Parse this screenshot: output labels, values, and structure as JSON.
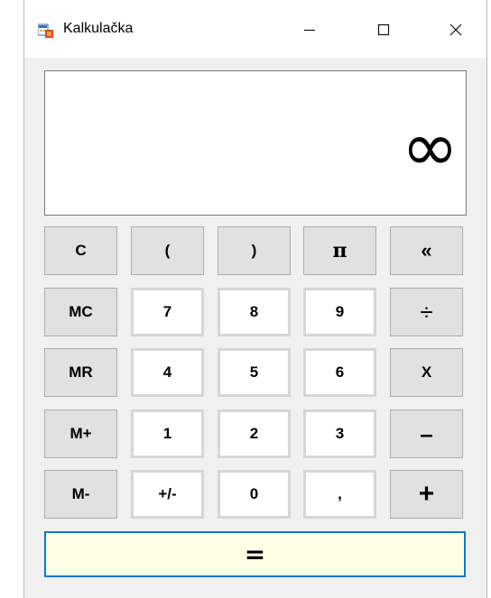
{
  "window": {
    "title": "Kalkulačka",
    "minimize_icon": "minimize-icon",
    "maximize_icon": "maximize-icon",
    "close_icon": "close-icon"
  },
  "display": {
    "value": "∞"
  },
  "keys": {
    "row1": [
      "C",
      "(",
      ")",
      "π",
      "«"
    ],
    "row2": [
      "MC",
      "7",
      "8",
      "9",
      "÷"
    ],
    "row3": [
      "MR",
      "4",
      "5",
      "6",
      "X"
    ],
    "row4": [
      "M+",
      "1",
      "2",
      "3",
      "–"
    ],
    "row5": [
      "M-",
      "+/-",
      "0",
      ",",
      "+"
    ]
  },
  "equals_label": "=",
  "colors": {
    "equals_bg": "#ffffe5",
    "equals_border": "#0078d7",
    "function_key_bg": "#e1e1e1",
    "digit_key_bg": "#ffffff"
  }
}
